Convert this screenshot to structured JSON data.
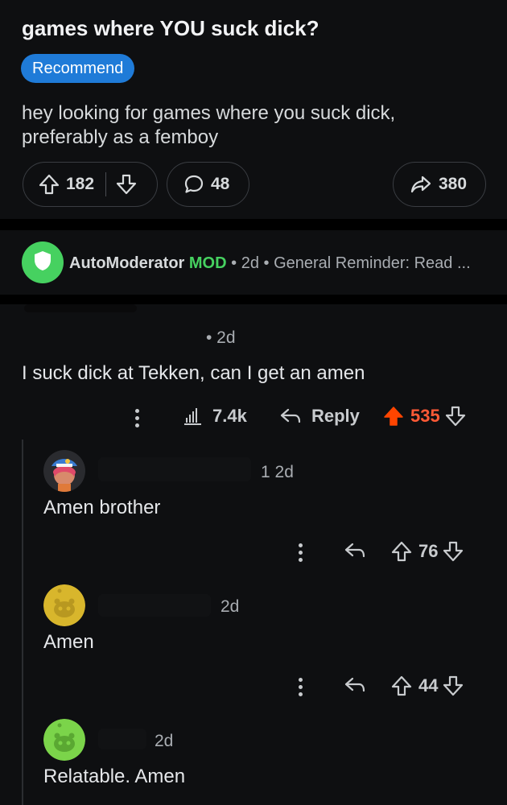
{
  "post": {
    "title": "games where YOU suck dick?",
    "flair": "Recommend",
    "body": "hey looking for games where you suck dick, preferably as a femboy",
    "upvotes": "182",
    "comments": "48",
    "shares": "380"
  },
  "automod": {
    "name": "AutoModerator",
    "badge": "MOD",
    "sep1": "•",
    "age": "2d",
    "sep2": "•",
    "preview": "General Reminder: Read ..."
  },
  "top_comment": {
    "meta": "• 2d",
    "text": "I suck dick at Tekken, can I get an amen",
    "views": "7.4k",
    "reply_label": "Reply",
    "score": "535"
  },
  "replies": [
    {
      "meta": "1 2d",
      "text": "Amen brother",
      "score": "76"
    },
    {
      "meta": "2d",
      "text": "Amen",
      "score": "44"
    },
    {
      "meta": "2d",
      "text": "Relatable. Amen"
    }
  ],
  "colors": {
    "accent_blue": "#1f7bd8",
    "mod_green": "#46d160",
    "upvote_orange": "#ff5a36"
  }
}
